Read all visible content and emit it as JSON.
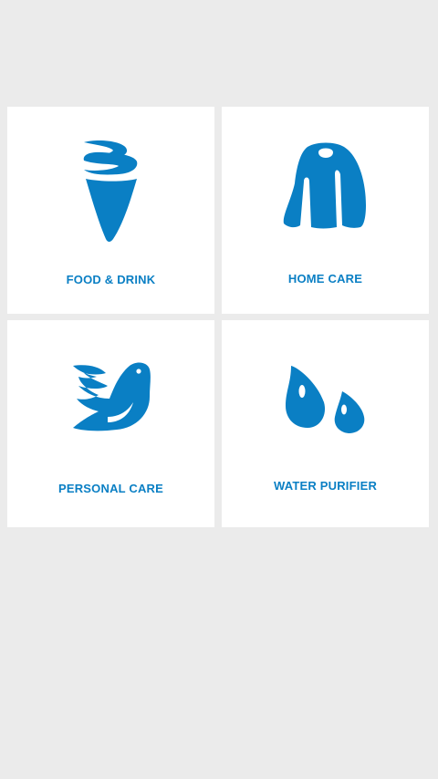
{
  "theme": {
    "accent": "#0a7fc4",
    "background": "#ebebeb",
    "tile_background": "#ffffff"
  },
  "categories": [
    {
      "label": "FOOD & DRINK",
      "icon": "ice-cream-cone-icon"
    },
    {
      "label": "HOME CARE",
      "icon": "sweater-icon"
    },
    {
      "label": "PERSONAL CARE",
      "icon": "dove-bird-icon"
    },
    {
      "label": "WATER PURIFIER",
      "icon": "water-drops-icon"
    }
  ]
}
